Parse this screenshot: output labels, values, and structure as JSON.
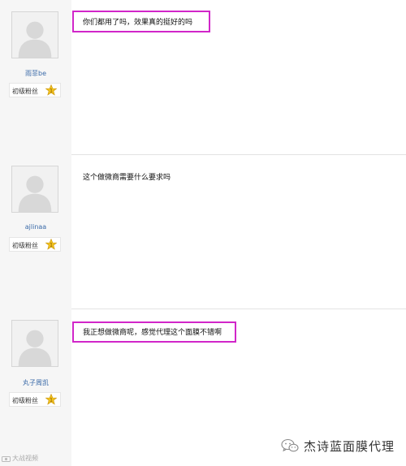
{
  "posts": [
    {
      "username": "雨菲be",
      "rank": "初级粉丝",
      "badge_level": "1",
      "message": "你们都用了吗，效果真的挺好的吗"
    },
    {
      "username": "ajlinaa",
      "rank": "初级粉丝",
      "badge_level": "1",
      "message": "这个做微商需要什么要求吗"
    },
    {
      "username": "丸子周凯",
      "rank": "初级粉丝",
      "badge_level": "1",
      "message": "我正想做微商呢，感觉代理这个面膜不错啊"
    }
  ],
  "footer_left": "大战视频",
  "watermark": "杰诗蓝面膜代理",
  "colors": {
    "highlight": "#d126c9",
    "username": "#3a6aa8",
    "author_background": "#f6f6f6"
  },
  "icons": {
    "avatar": "default-user-silhouette-icon",
    "badge": "star-badge-icon",
    "watermark": "wechat-icon"
  }
}
